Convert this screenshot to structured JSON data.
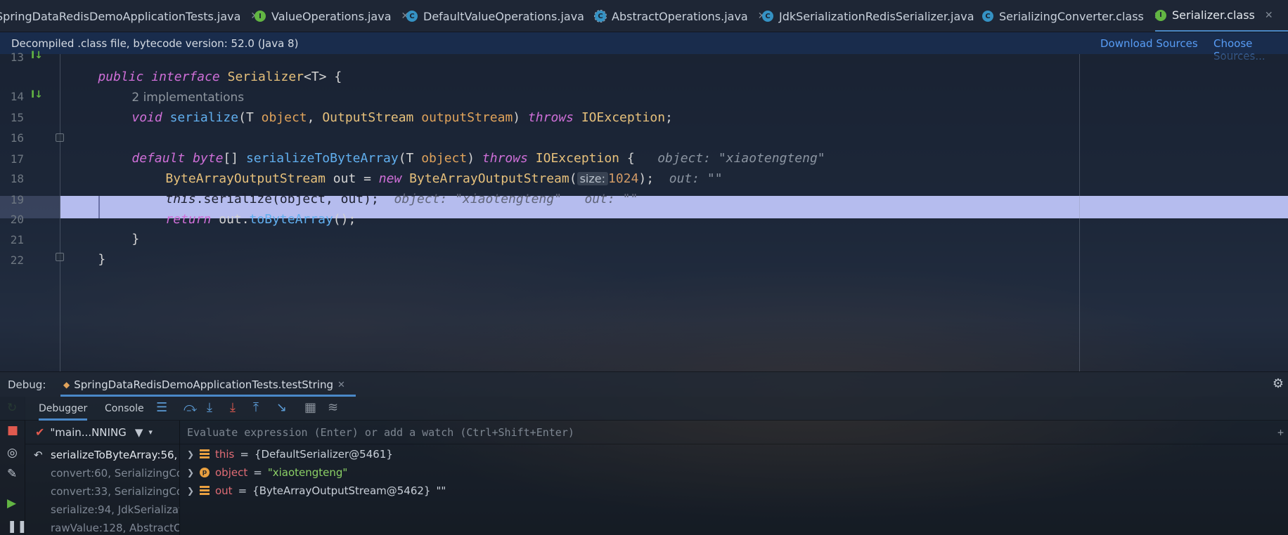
{
  "tabs": [
    {
      "label": "SpringDataRedisDemoApplicationTests.java",
      "icon": "none",
      "active": false
    },
    {
      "label": "ValueOperations.java",
      "icon": "interface-icon",
      "active": false
    },
    {
      "label": "DefaultValueOperations.java",
      "icon": "class-icon",
      "active": false
    },
    {
      "label": "AbstractOperations.java",
      "icon": "abstract-class-icon",
      "active": false
    },
    {
      "label": "JdkSerializationRedisSerializer.java",
      "icon": "class-icon",
      "active": false
    },
    {
      "label": "SerializingConverter.class",
      "icon": "class-icon",
      "active": false
    },
    {
      "label": "Serializer.class",
      "icon": "interface-icon",
      "active": true
    }
  ],
  "tab_close": "✕",
  "decompiled": {
    "message": "Decompiled .class file, bytecode version: 52.0 (Java 8)",
    "download_sources": "Download Sources",
    "choose_sources": "Choose Sources..."
  },
  "editor": {
    "line_numbers": [
      "13",
      "14",
      "15",
      "16",
      "17",
      "18",
      "19",
      "20",
      "21",
      "22"
    ],
    "implementations_hint": "2 implementations",
    "code": {
      "l13": {
        "kw1": "public",
        "kw2": "interface",
        "name": "Serializer",
        "rest": "<T> {"
      },
      "l14": {
        "kw": "void",
        "fn": "serialize",
        "p1": "(T ",
        "a1": "object",
        "p2": ", ",
        "t2": "OutputStream",
        "a2": "outputStream",
        "p3": ") ",
        "kw2": "throws",
        "ex": "IOException",
        "end": ";"
      },
      "l16": {
        "kw1": "default",
        "kw2": "byte",
        "br": "[] ",
        "fn": "serializeToByteArray",
        "p1": "(T ",
        "a1": "object",
        "p2": ") ",
        "kw3": "throws",
        "ex": "IOException",
        "end": " {",
        "hint": "object: \"xiaotengteng\""
      },
      "l17": {
        "t1": "ByteArrayOutputStream",
        "p1": " out = ",
        "kw": "new",
        "t2": "ByteArrayOutputStream",
        "p2": "(",
        "hint_label": "size:",
        "num": "1024",
        "end": ");",
        "hint": "out: \"\""
      },
      "l18": {
        "kw": "this",
        "rest": ".serialize(object, out);",
        "hint1": "object: \"xiaotengteng\"",
        "hint2": "out: \"\""
      },
      "l19": {
        "kw": "return",
        "p1": " out.",
        "fn": "toByteArray",
        "end": "();"
      },
      "l20": {
        "text": "}"
      },
      "l21": {
        "text": "}"
      }
    }
  },
  "debug": {
    "label": "Debug:",
    "session": "SpringDataRedisDemoApplicationTests.testString",
    "tabs": {
      "debugger": "Debugger",
      "console": "Console"
    },
    "thread": "\"main...NNING",
    "frames": [
      "serializeToByteArray:56, S",
      "convert:60, SerializingCor",
      "convert:33, SerializingCor",
      "serialize:94, JdkSerializati",
      "rawValue:128, AbstractOp"
    ],
    "eval_placeholder": "Evaluate expression (Enter) or add a watch (Ctrl+Shift+Enter)",
    "variables": [
      {
        "name": "this",
        "eq": " = ",
        "value": "{DefaultSerializer@5461}",
        "str": "",
        "icon": "field-icon"
      },
      {
        "name": "object",
        "eq": " = ",
        "value": "",
        "str": "\"xiaotengteng\"",
        "icon": "parameter-icon"
      },
      {
        "name": "out",
        "eq": " = ",
        "value": "{ByteArrayOutputStream@5462} ",
        "str": "\"\"",
        "icon": "field-icon"
      }
    ]
  },
  "colors": {
    "accent": "#4a88c7",
    "execution_highlight": "#b5bcee",
    "link": "#589df6"
  }
}
